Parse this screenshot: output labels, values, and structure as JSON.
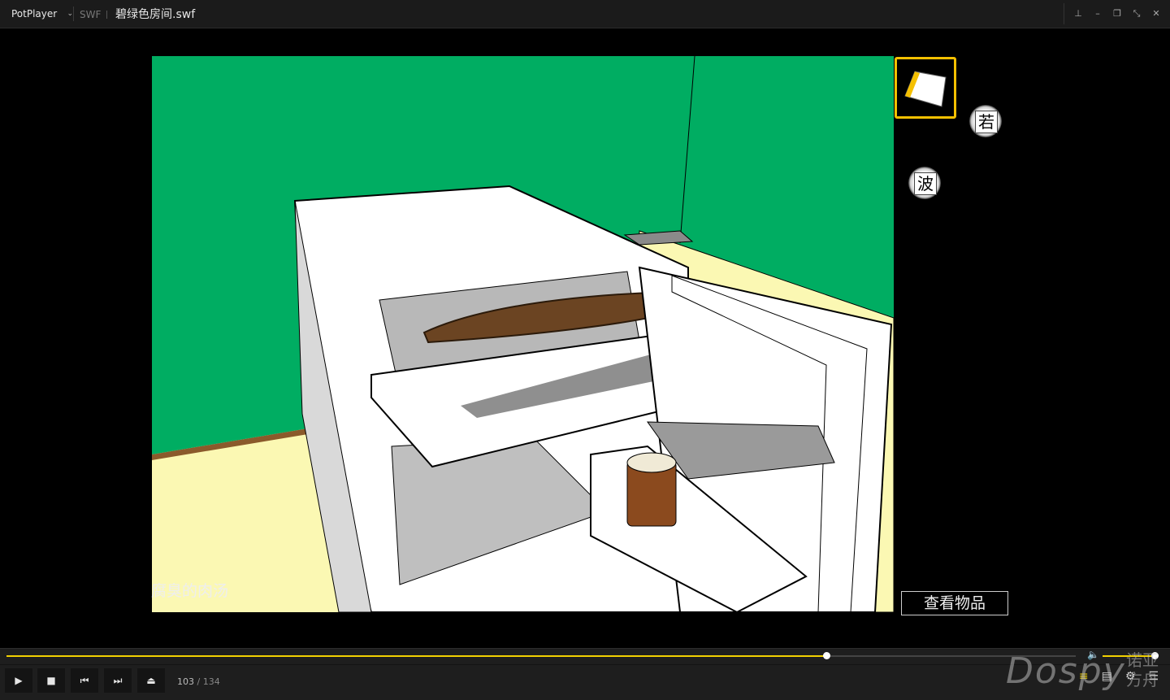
{
  "titlebar": {
    "app_name": "PotPlayer",
    "chevron_icon": "chevron-down-icon",
    "format": "SWF",
    "file_title": "碧绿色房间.swf",
    "buttons": [
      "pin-icon",
      "minimize-icon",
      "restore-icon",
      "fullscreen-icon",
      "close-icon"
    ]
  },
  "game": {
    "inventory_item_icon": "note-paper-icon",
    "char_buttons": [
      "若",
      "波"
    ],
    "caption": "腐臭的肉汤",
    "inspect_button": "查看物品",
    "colors": {
      "wall": "#00ad62",
      "floor": "#fbf8b3",
      "selection": "#f5c000"
    }
  },
  "player": {
    "seek_progress": 0.767,
    "volume": 0.97,
    "current_frame": "103",
    "separator": "/",
    "total_frames": "134",
    "accent_color": "#f1d000",
    "left_buttons": [
      "play-icon",
      "stop-icon",
      "previous-icon",
      "next-icon",
      "eject-icon"
    ],
    "right_buttons": [
      "playlist-search-icon",
      "chapters-icon",
      "settings-icon",
      "menu-icon"
    ]
  },
  "watermark": {
    "text": "Dospy",
    "cn": "诺亚方舟"
  }
}
